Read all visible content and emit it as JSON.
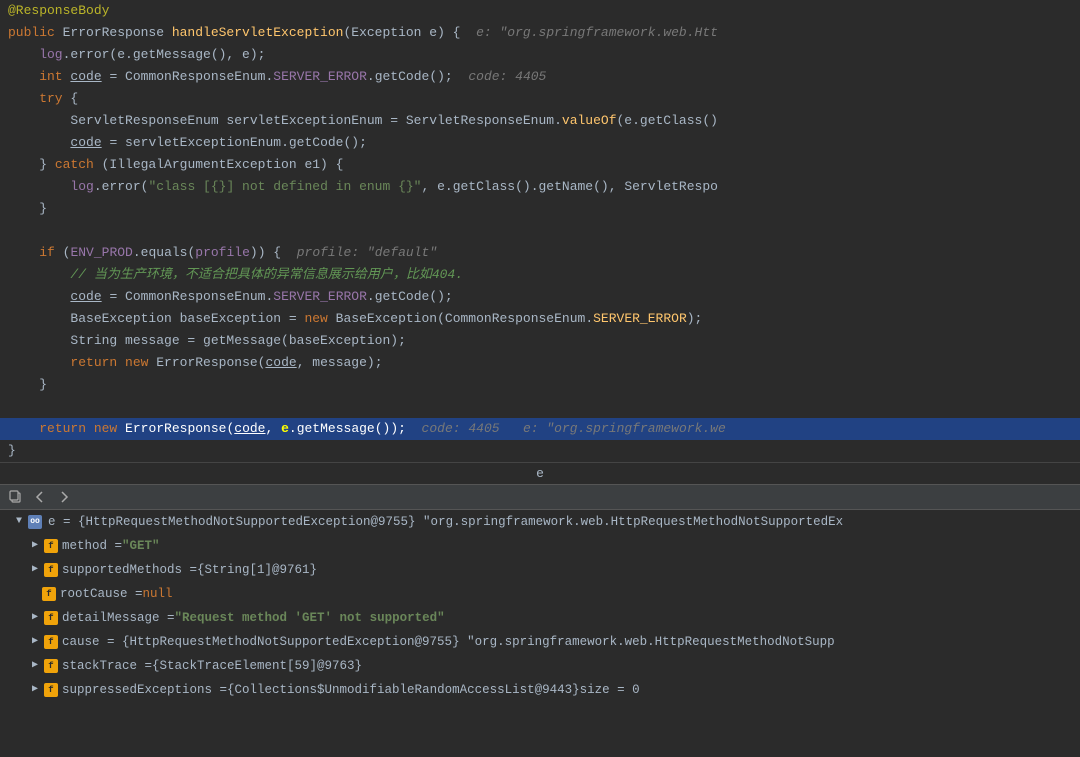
{
  "colors": {
    "bg": "#2b2b2b",
    "highlight_line": "#214283",
    "toolbar_bg": "#3c3f41",
    "keyword": "#cc7832",
    "string": "#6a8759",
    "comment": "#808080",
    "method": "#ffc66d",
    "field": "#9876aa",
    "number": "#6897bb",
    "annotation": "#bbb529"
  },
  "code": {
    "lines": [
      {
        "id": "l1",
        "text": "@ResponseBody",
        "type": "annotation"
      },
      {
        "id": "l2",
        "text": "public ErrorResponse handleServletException(Exception e) {",
        "type": "normal",
        "hint": "  e: \"org.springframework.web.Htt"
      },
      {
        "id": "l3",
        "text": "    log.error(e.getMessage(), e);",
        "type": "normal"
      },
      {
        "id": "l4",
        "text": "    int code = CommonResponseEnum.SERVER_ERROR.getCode();",
        "type": "normal",
        "hint": "  code: 4405"
      },
      {
        "id": "l5",
        "text": "    try {",
        "type": "normal"
      },
      {
        "id": "l6",
        "text": "        ServletResponseEnum servletExceptionEnum = ServletResponseEnum.valueOf(e.getClass()",
        "type": "normal"
      },
      {
        "id": "l7",
        "text": "        code = servletExceptionEnum.getCode();",
        "type": "normal"
      },
      {
        "id": "l8",
        "text": "    } catch (IllegalArgumentException e1) {",
        "type": "normal"
      },
      {
        "id": "l9",
        "text": "        log.error(\"class [{}] not defined in enum {}\", e.getClass().getName(), ServletRespo",
        "type": "normal"
      },
      {
        "id": "l10",
        "text": "    }",
        "type": "normal"
      },
      {
        "id": "l11",
        "text": "",
        "type": "empty"
      },
      {
        "id": "l12",
        "text": "    if (ENV_PROD.equals(profile)) {",
        "type": "normal",
        "hint": "  profile: \"default\""
      },
      {
        "id": "l13",
        "text": "        // 当为生产环境，不适合把具体的异常信息展示给用户，比如404.",
        "type": "comment"
      },
      {
        "id": "l14",
        "text": "        code = CommonResponseEnum.SERVER_ERROR.getCode();",
        "type": "normal"
      },
      {
        "id": "l15",
        "text": "        BaseException baseException = new BaseException(CommonResponseEnum.SERVER_ERROR);",
        "type": "normal"
      },
      {
        "id": "l16",
        "text": "        String message = getMessage(baseException);",
        "type": "normal"
      },
      {
        "id": "l17",
        "text": "        return new ErrorResponse(code, message);",
        "type": "normal"
      },
      {
        "id": "l18",
        "text": "    }",
        "type": "normal"
      },
      {
        "id": "l19",
        "text": "",
        "type": "empty"
      }
    ],
    "highlighted_line": "    return new ErrorResponse(code, e.getMessage());",
    "highlighted_hint": "  code: 4405   e: \"org.springframework.we",
    "closing_brace": "}"
  },
  "debugger": {
    "toolbar": {
      "icons": [
        "copy",
        "back",
        "forward"
      ]
    },
    "e_label": "e",
    "root_var": {
      "name": "e",
      "type": "HttpRequestMethodNotSupportedException@9755",
      "value": "\"org.springframework.web.HttpRequestMethodNotSupportedEx"
    },
    "fields": [
      {
        "id": "f1",
        "indent": 1,
        "name": "method",
        "value": "\"GET\"",
        "value_type": "string",
        "expandable": true
      },
      {
        "id": "f2",
        "indent": 1,
        "name": "supportedMethods",
        "value": "{String[1]@9761}",
        "value_type": "ref",
        "expandable": true
      },
      {
        "id": "f3",
        "indent": 1,
        "name": "rootCause",
        "value": "null",
        "value_type": "null",
        "expandable": false
      },
      {
        "id": "f4",
        "indent": 1,
        "name": "detailMessage",
        "value": "\"Request method 'GET' not supported\"",
        "value_type": "string",
        "expandable": true
      },
      {
        "id": "f5",
        "indent": 1,
        "name": "cause",
        "value": "{HttpRequestMethodNotSupportedException@9755} \"org.springframework.web.HttpRequestMethodNotSupp",
        "value_type": "ref",
        "expandable": true
      },
      {
        "id": "f6",
        "indent": 1,
        "name": "stackTrace",
        "value": "{StackTraceElement[59]@9763}",
        "value_type": "ref",
        "expandable": true
      },
      {
        "id": "f7",
        "indent": 1,
        "name": "suppressedExceptions",
        "value": "{Collections$UnmodifiableRandomAccessList@9443}  size = 0",
        "value_type": "ref",
        "expandable": true
      }
    ]
  }
}
